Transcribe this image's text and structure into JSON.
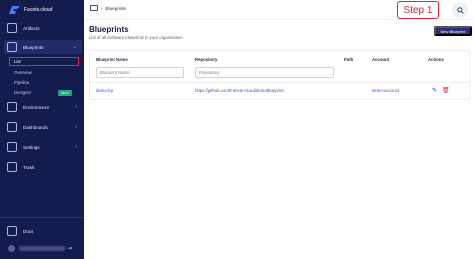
{
  "app": {
    "logo_text": "Facets.cloud"
  },
  "sidebar": {
    "items": [
      {
        "label": "Artifacts"
      },
      {
        "label": "Blueprints"
      },
      {
        "label": "Environment"
      },
      {
        "label": "Dashboards"
      },
      {
        "label": "Settings"
      },
      {
        "label": "Trash"
      }
    ],
    "blueprint_subitems": [
      {
        "label": "List"
      },
      {
        "label": "Overview"
      },
      {
        "label": "Pipeline"
      },
      {
        "label": "Designer",
        "badge": "BETA"
      }
    ],
    "docs_label": "Docs",
    "colors": {
      "background": "#141b4d",
      "highlight": "#e0273b"
    }
  },
  "topbar": {
    "breadcrumb": [
      "Blueprints"
    ],
    "step_label": "Step 1"
  },
  "page": {
    "title": "Blueprints",
    "subtitle": "List of all Software blueprints in your organization",
    "new_button_label": "New Blueprint"
  },
  "table": {
    "headers": {
      "name": "Blueprint Name",
      "repository": "Repository",
      "path": "Path",
      "account": "Account",
      "actions": "Actions"
    },
    "filters": {
      "name_placeholder": "Blueprint Name",
      "repository_placeholder": "Repository"
    },
    "rows": [
      {
        "name": "demo-bp",
        "repository": "https://github.com/Facets-cloud/demoBlueprint",
        "path": "",
        "account": "demo-account"
      }
    ]
  }
}
